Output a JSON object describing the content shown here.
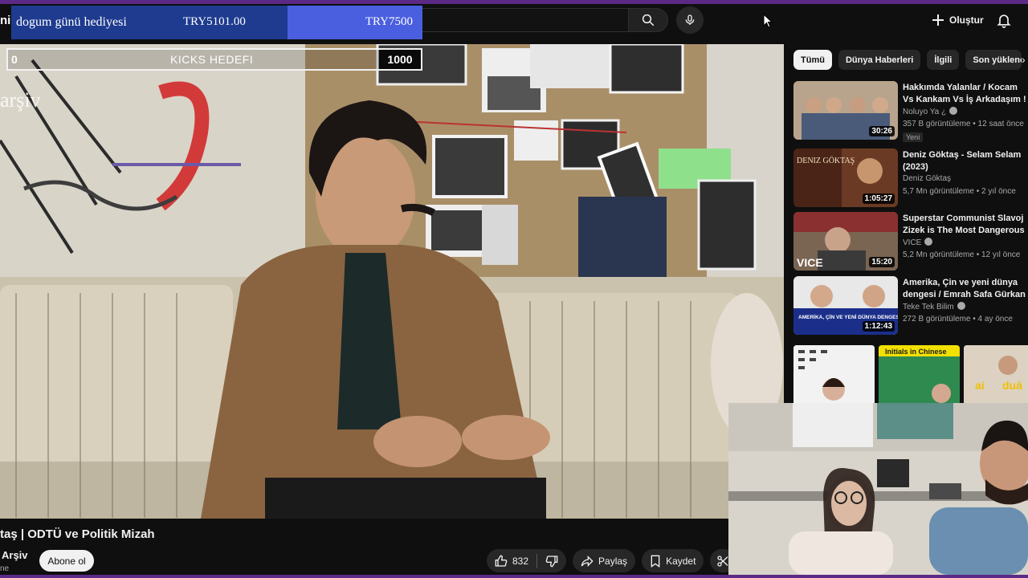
{
  "header": {
    "logo_fragment": "ni",
    "create_label": "Oluştur",
    "icons": [
      "search-icon",
      "mic-icon",
      "plus-icon",
      "bell-icon"
    ]
  },
  "overlay": {
    "goal_title": "dogum günü hediyesi",
    "goal_current": "TRY5101.00",
    "goal_target": "TRY7500",
    "kicks_current": "0",
    "kicks_label": "KICKS HEDEFI",
    "kicks_max": "1000",
    "watermark": "arşiv"
  },
  "video": {
    "title": "taş | ODTÜ ve Politik Mizah",
    "channel": "Arşiv",
    "channel_sub": "ne",
    "subscribe_label": "Abone ol",
    "like_count": "832",
    "share_label": "Paylaş",
    "save_label": "Kaydet"
  },
  "sidebar": {
    "chips": [
      "Tümü",
      "Dünya Haberleri",
      "İlgili",
      "Son yüklenen"
    ],
    "recommendations": [
      {
        "title": "Hakkımda Yalanlar / Kocam Vs Kankam Vs İş Arkadaşım !",
        "channel": "Noluyo Ya ¿",
        "meta": "357 B görüntüleme • 12 saat önce",
        "badge": "Yeni",
        "duration": "30:26"
      },
      {
        "title": "Deniz Göktaş - Selam Selam (2023)",
        "channel": "Deniz Göktaş",
        "meta": "5,7 Mn görüntüleme • 2 yıl önce",
        "badge": "",
        "duration": "1:05:27",
        "thumb_text": "DENIZ GÖKTAŞ"
      },
      {
        "title": "Superstar Communist Slavoj Zizek is The Most Dangerous Philosopher",
        "channel": "VICE",
        "meta": "5,2 Mn görüntüleme • 12 yıl önce",
        "badge": "",
        "duration": "15:20",
        "thumb_text": "VICE"
      },
      {
        "title": "Amerika, Çin ve yeni dünya dengesi / Emrah Safa Gürkan ...",
        "channel": "Teke Tek Bilim",
        "meta": "272 B görüntüleme • 4 ay önce",
        "badge": "",
        "duration": "1:12:43",
        "thumb_text": "AMERİKA, ÇİN VE YENİ DÜNYA DENGESİ"
      }
    ],
    "shorts_labels": [
      "Initials in Chinese"
    ]
  },
  "colors": {
    "accent_purple": "#5b2a86",
    "goal_left_bg": "#1e3b8f",
    "goal_right_bg": "#4a5fe0",
    "background": "#0f0f0f"
  }
}
